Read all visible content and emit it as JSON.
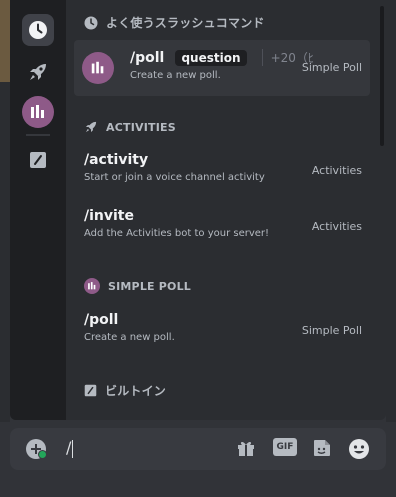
{
  "rail": {
    "items": [
      {
        "name": "frequently-used",
        "icon": "clock-icon"
      },
      {
        "name": "activities",
        "icon": "rocket-icon"
      },
      {
        "name": "simple-poll",
        "icon": "poll-bot-icon"
      },
      {
        "name": "built-in",
        "icon": "slash-command-icon"
      }
    ]
  },
  "frequent": {
    "header": "よく使うスラッシュコマンド",
    "command": {
      "name": "/poll",
      "param": "question",
      "more": "+20（ﾋ",
      "desc": "Create a new poll.",
      "source": "Simple Poll"
    }
  },
  "activities": {
    "header": "ACTIVITIES",
    "commands": [
      {
        "name": "/activity",
        "desc": "Start or join a voice channel activity",
        "source": "Activities"
      },
      {
        "name": "/invite",
        "desc": "Add the Activities bot to your server!",
        "source": "Activities"
      }
    ]
  },
  "simple_poll": {
    "header": "SIMPLE POLL",
    "commands": [
      {
        "name": "/poll",
        "desc": "Create a new poll.",
        "source": "Simple Poll"
      }
    ]
  },
  "builtin": {
    "header": "ビルトイン"
  },
  "composer": {
    "value": "/",
    "icons": [
      "gift-icon",
      "gif-icon",
      "sticker-icon",
      "emoji-icon"
    ],
    "gif_label": "GIF"
  },
  "colors": {
    "accent_poll": "#8e5a88",
    "panel": "#2b2d31",
    "rail": "#1e1f22"
  }
}
